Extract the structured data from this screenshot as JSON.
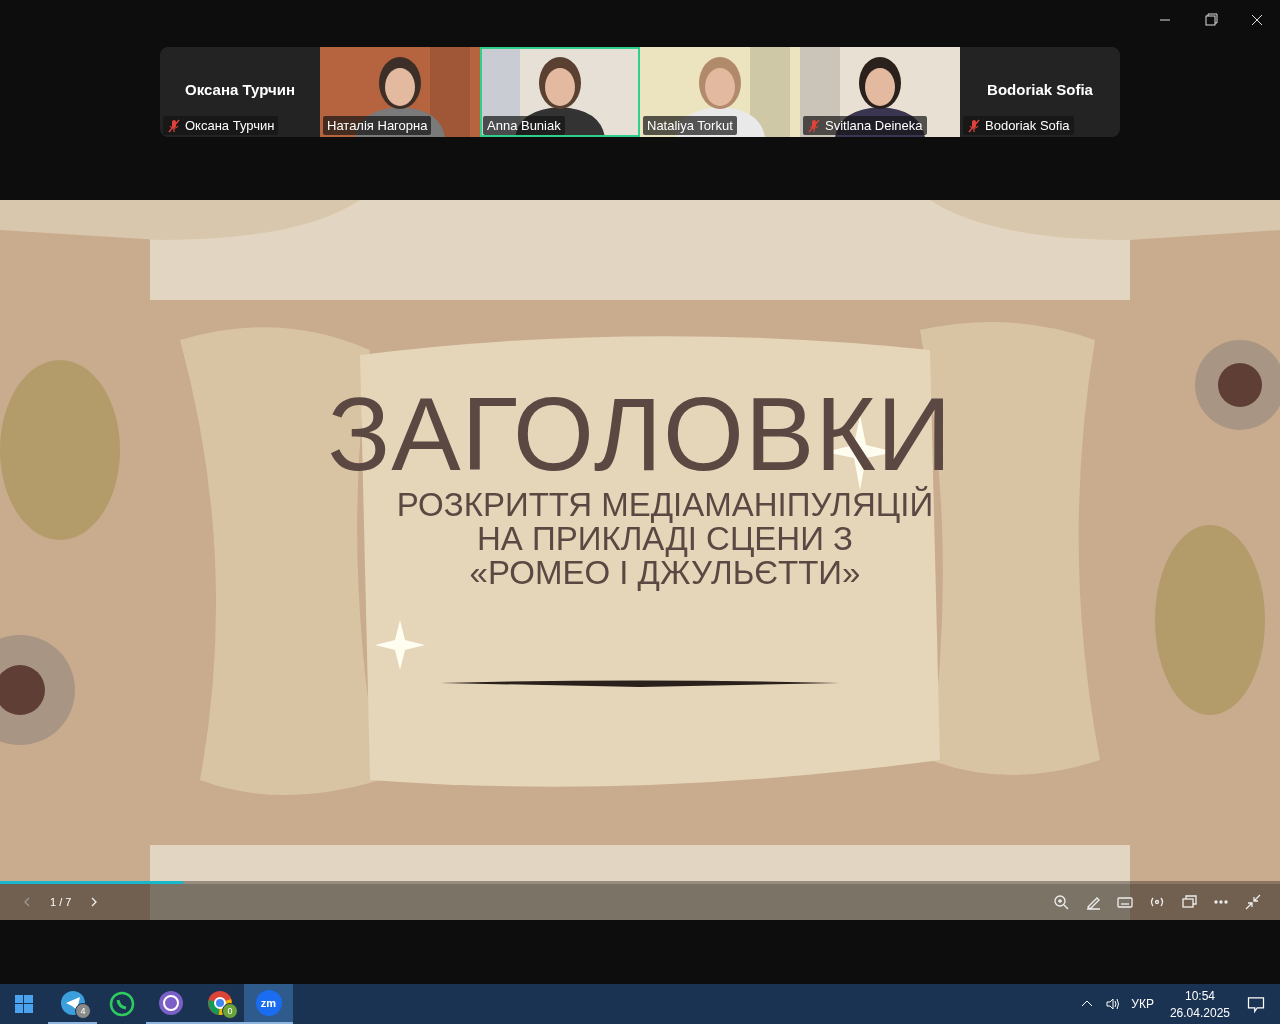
{
  "participants": [
    {
      "kind": "no-video",
      "center_name": "Оксана Турчин",
      "name": "Оксана Турчин",
      "muted": true,
      "speaking": false
    },
    {
      "kind": "video",
      "name": "Наталія Нагорна",
      "muted": false,
      "speaking": false
    },
    {
      "kind": "video",
      "name": "Anna Buniak",
      "muted": false,
      "speaking": true
    },
    {
      "kind": "video",
      "name": "Nataliya Torkut",
      "muted": false,
      "speaking": false
    },
    {
      "kind": "video",
      "name": "Svitlana Deineka",
      "muted": true,
      "speaking": false
    },
    {
      "kind": "no-video",
      "center_name": "Bodoriak Sofia",
      "name": "Bodoriak Sofia",
      "muted": true,
      "speaking": false
    }
  ],
  "slide": {
    "title": "ЗАГОЛОВКИ",
    "subtitle_lines": [
      "РОЗКРИТТЯ МЕДІАМАНІПУЛЯЦІЙ",
      "НА ПРИКЛАДІ СЦЕНИ З",
      "«РОМЕО І ДЖУЛЬЄТТИ»"
    ],
    "level": 0.143
  },
  "slide_toolbar": {
    "page": "1 / 7"
  },
  "taskbar": {
    "apps": [
      {
        "kind": "telegram",
        "badge": "4",
        "running": true,
        "selected": false
      },
      {
        "kind": "whatsapp",
        "running": false,
        "selected": false
      },
      {
        "kind": "viber",
        "running": true,
        "selected": false
      },
      {
        "kind": "chrome",
        "badge": "0",
        "running": true,
        "selected": false
      },
      {
        "kind": "zoom",
        "label": "zm",
        "running": true,
        "selected": true
      }
    ],
    "language": "УКР",
    "time": "10:54",
    "date": "26.04.2025"
  }
}
